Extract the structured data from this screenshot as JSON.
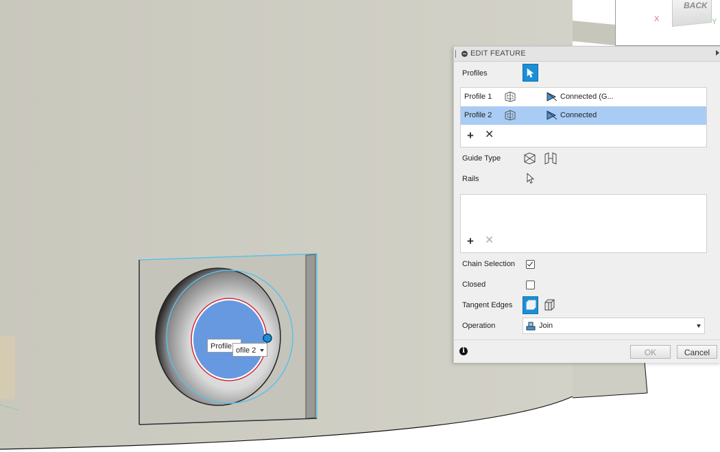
{
  "viewcube": {
    "face_label": "BACK",
    "axis_x": "X",
    "axis_y": "Y"
  },
  "viewport_tags": {
    "profile1": "Profile 1",
    "profile2": "ofile 2"
  },
  "panel": {
    "title": "EDIT FEATURE",
    "profiles_label": "Profiles",
    "profiles": [
      {
        "name": "Profile 1",
        "continuity": "Connected (G...",
        "selected": false
      },
      {
        "name": "Profile 2",
        "continuity": "Connected",
        "selected": true
      }
    ],
    "guide_type_label": "Guide Type",
    "rails_label": "Rails",
    "chain_selection_label": "Chain Selection",
    "chain_selection_checked": true,
    "closed_label": "Closed",
    "closed_checked": false,
    "tangent_edges_label": "Tangent Edges",
    "operation_label": "Operation",
    "operation_value": "Join",
    "ok_label": "OK",
    "cancel_label": "Cancel"
  },
  "icons": {
    "select": "cursor-arrow-icon",
    "profile": "profile-plane-icon",
    "continuity": "continuity-icon",
    "add": "plus-icon",
    "remove": "x-icon",
    "info": "info-icon"
  },
  "colors": {
    "accent": "#1b8fd6",
    "selection": "#a9ccf5",
    "profile_fill": "#6699e0",
    "edge_highlight": "#5bc0eb"
  }
}
